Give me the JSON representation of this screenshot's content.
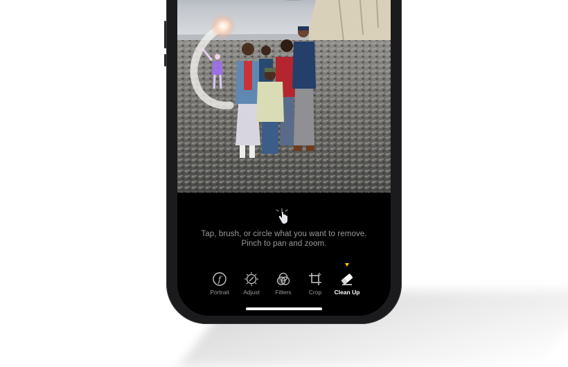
{
  "editor": {
    "hint_line1": "Tap, brush, or circle what you want to remove.",
    "hint_line2": "Pinch to pan and zoom."
  },
  "toolbar": {
    "tools": [
      {
        "label": "Portrait",
        "icon": "portrait-f-icon",
        "selected": false
      },
      {
        "label": "Adjust",
        "icon": "adjust-dial-icon",
        "selected": false
      },
      {
        "label": "Filters",
        "icon": "filters-circles-icon",
        "selected": false
      },
      {
        "label": "Crop",
        "icon": "crop-icon",
        "selected": false
      },
      {
        "label": "Clean Up",
        "icon": "eraser-icon",
        "selected": true
      }
    ]
  },
  "colors": {
    "selection_indicator": "#ffcc00",
    "active_label": "#ffffff",
    "inactive_label": "#9a9a9e"
  }
}
